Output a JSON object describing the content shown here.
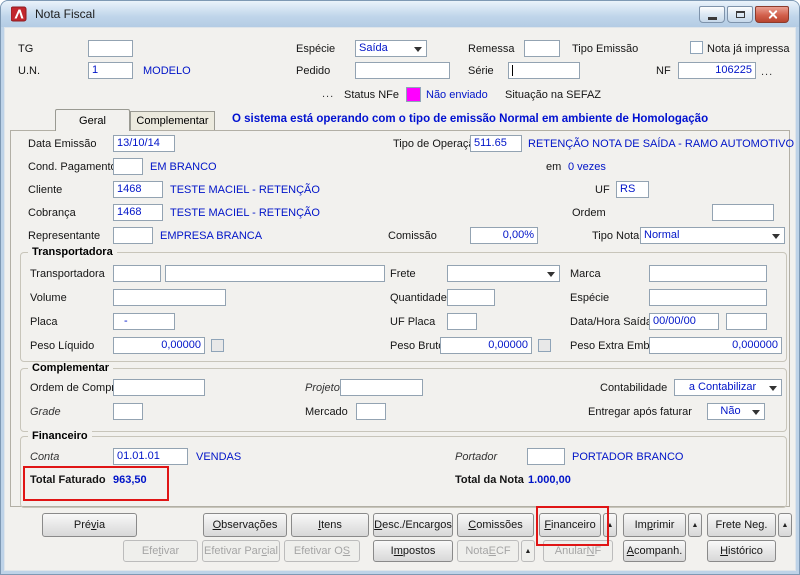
{
  "window": {
    "title": "Nota Fiscal",
    "icon": "app-icon-red",
    "controls": {
      "minimize": "minimize-icon",
      "maximize": "maximize-icon",
      "close": "close-icon"
    }
  },
  "header": {
    "tg_label": "TG",
    "tg_value": "",
    "un_label": "U.N.",
    "un_value": "1",
    "un_desc": "MODELO",
    "especie_label": "Espécie",
    "especie_value": "Saída",
    "pedido_label": "Pedido",
    "pedido_value": "",
    "remessa_label": "Remessa",
    "remessa_value": "",
    "serie_label": "Série",
    "serie_value": "",
    "tipo_emissao_label": "Tipo Emissão",
    "nota_impressa_label": "Nota já impressa",
    "nf_label": "NF",
    "nf_value": "106225",
    "nf_browse": "...",
    "status_browse": "...",
    "status_label": "Status NFe",
    "status_value": "Não enviado",
    "status_color": "#ff00ff",
    "sefaz_label": "Situação na SEFAZ"
  },
  "tabs": {
    "geral": "Geral",
    "complementar": "Complementar",
    "message": "O sistema está operando com o tipo de emissão Normal em ambiente de Homologação"
  },
  "geral": {
    "data_emissao_label": "Data Emissão",
    "data_emissao_value": "13/10/14",
    "tipo_operacao_label": "Tipo de Operação",
    "tipo_operacao_value": "511.65",
    "tipo_operacao_desc": "RETENÇÃO NOTA DE SAÍDA - RAMO AUTOMOTIVO",
    "cond_pagamento_label": "Cond. Pagamento",
    "cond_pagamento_value": "",
    "cond_pagamento_desc": "EM BRANCO",
    "em_label": "em",
    "vezes_value": "0 vezes",
    "cliente_label": "Cliente",
    "cliente_value": "1468",
    "cliente_desc": "TESTE MACIEL - RETENÇÃO",
    "uf_label": "UF",
    "uf_value": "RS",
    "cobranca_label": "Cobrança",
    "cobranca_value": "1468",
    "cobranca_desc": "TESTE MACIEL - RETENÇÃO",
    "ordem_label": "Ordem",
    "ordem_value": "",
    "representante_label": "Representante",
    "representante_value": "",
    "representante_desc": "EMPRESA BRANCA",
    "comissao_label": "Comissão",
    "comissao_value": "0,00%",
    "tipo_nota_label": "Tipo Nota",
    "tipo_nota_value": "Normal"
  },
  "transportadora": {
    "legend": "Transportadora",
    "transportadora_label": "Transportadora",
    "transportadora_code": "",
    "transportadora_name": "",
    "frete_label": "Frete",
    "frete_value": "",
    "marca_label": "Marca",
    "marca_value": "",
    "volume_label": "Volume",
    "volume_value": "",
    "quantidade_label": "Quantidade",
    "quantidade_value": "",
    "especie_label": "Espécie",
    "especie_value": "",
    "placa_label": "Placa",
    "placa_value": "-",
    "uf_placa_label": "UF Placa",
    "uf_placa_value": "",
    "data_hora_saida_label": "Data/Hora Saída",
    "data_saida_value": "00/00/00",
    "hora_saida_value": "",
    "peso_liquido_label": "Peso Líquido",
    "peso_liquido_value": "0,00000",
    "peso_bruto_label": "Peso Bruto",
    "peso_bruto_value": "0,00000",
    "peso_extra_label": "Peso Extra Emb.",
    "peso_extra_value": "0,000000"
  },
  "complementar": {
    "legend": "Complementar",
    "ordem_compra_label": "Ordem de Compra",
    "ordem_compra_value": "",
    "projeto_label": "Projeto",
    "projeto_value": "",
    "contabilidade_label": "Contabilidade",
    "contabilidade_value": "a Contabilizar",
    "grade_label": "Grade",
    "grade_value": "",
    "mercado_label": "Mercado",
    "mercado_value": "",
    "entregar_label": "Entregar após faturar",
    "entregar_value": "Não"
  },
  "financeiro": {
    "legend": "Financeiro",
    "conta_label": "Conta",
    "conta_value": "01.01.01",
    "conta_desc": "VENDAS",
    "portador_label": "Portador",
    "portador_value": "",
    "portador_desc": "PORTADOR BRANCO",
    "total_faturado_label": "Total Faturado",
    "total_faturado_value": "963,50",
    "total_nota_label": "Total da Nota",
    "total_nota_value": "1.000,00"
  },
  "buttons": {
    "previa": "Pré&via",
    "observacoes": "&Observações",
    "itens": "&Itens",
    "desc_encargos": "&Desc./Encargos",
    "comissoes": "&Comissões",
    "financeiro": "&Financeiro",
    "imprimir": "Im&primir",
    "frete_neg": "Frete Ne&g.",
    "efetivar": "Efe&tivar",
    "efetivar_parcial": "Efetivar Par&cial",
    "efetivar_os": "Efetivar O&S",
    "impostos": "I&mpostos",
    "nota_ecf": "Nota &ECF",
    "anular_nf": "Anular &NF",
    "acompanh": "&Acompanh.",
    "historico": "&Histórico",
    "up_arrow": "▲"
  },
  "annotations": {
    "color": "#e01515"
  }
}
